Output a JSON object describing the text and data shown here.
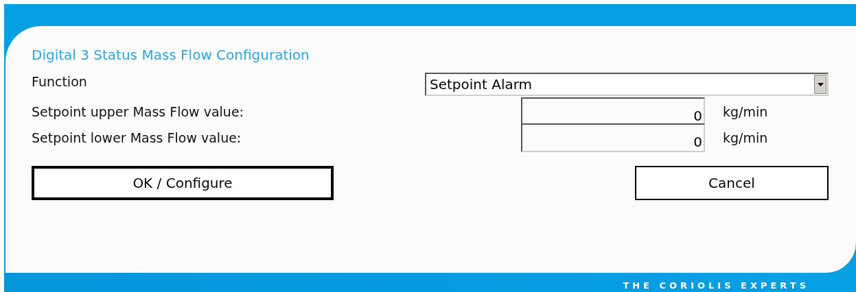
{
  "dialog": {
    "title": "Digital 3 Status Mass Flow Configuration",
    "function": {
      "label": "Function",
      "value": "Setpoint Alarm"
    },
    "fields": [
      {
        "label": "Setpoint upper Mass Flow value:",
        "value": "0",
        "unit": "kg/min"
      },
      {
        "label": "Setpoint lower Mass Flow value:",
        "value": "0",
        "unit": "kg/min"
      }
    ],
    "buttons": [
      {
        "label": "OK / Configure",
        "default": true
      },
      {
        "label": "Cancel",
        "default": false
      }
    ]
  },
  "footer": {
    "tagline": "THE CORIOLIS EXPERTS"
  }
}
